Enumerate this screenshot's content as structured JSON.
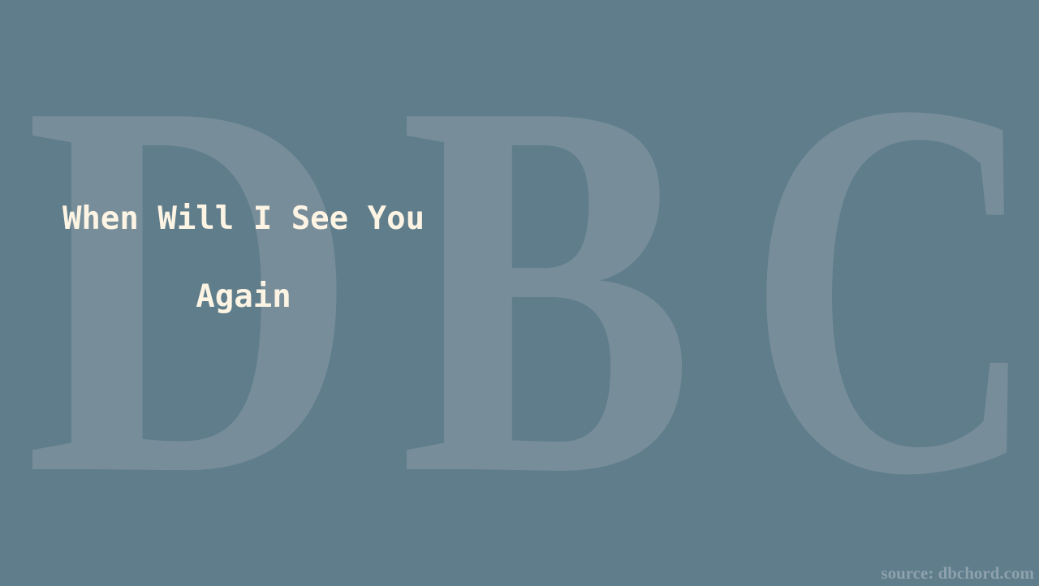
{
  "watermark": {
    "letters": [
      "D",
      "B",
      "C"
    ],
    "text": "DBC"
  },
  "song": {
    "title_line1": "When Will I See You",
    "title_line2": "Again"
  },
  "footer": {
    "source": "source: dbchord.com"
  },
  "colors": {
    "background": "#607d8c",
    "watermark": "#778e9a",
    "title": "#fdf4e3",
    "source": "#8ea2ad"
  }
}
